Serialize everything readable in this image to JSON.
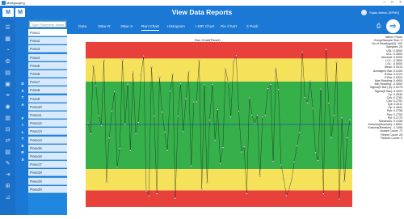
{
  "window": {
    "title": "Multigauging"
  },
  "header": {
    "title": "View Data Reports",
    "logo_text": "M",
    "user": "Sujan Ashok (SPM0)"
  },
  "filters_label": "DATA FILTERS",
  "search": {
    "placeholder": "Type Parameter Name"
  },
  "params": [
    "Para1",
    "Para2",
    "Para3",
    "Para4",
    "Para5",
    "Para6",
    "Para7",
    "Para8",
    "Para9",
    "Para10",
    "Para11",
    "Para12",
    "Para13",
    "Para14",
    "Para15",
    "Para16",
    "Para17",
    "Para18",
    "Para19",
    "Para20"
  ],
  "tabs": [
    "Data",
    "XBar-R",
    "XBar-S",
    "Run Chart",
    "Histogram",
    "I-MR Chart",
    "Pie Chart",
    "3 Pack"
  ],
  "active_tab": "Run Chart",
  "colors": {
    "header": "#1b78d4",
    "red": "#e8413c",
    "yellow": "#f6e15a",
    "green": "#36b04a"
  },
  "chart_title": "Run Chart(Para1)",
  "stats": [
    "Name: Para1",
    "Group/Sample Size: 5",
    "No of Readings(N): 100",
    "Samples: 20",
    "USL: 0.5000",
    "UCL: 0.3500",
    "Nominal: 0.0000",
    "LCL: -0.3500",
    "LSL: -0.5000",
    "Mean: 0.0013",
    "Average/X Bar: 0.0105",
    "R Bar: 0.0724",
    "S Bar: 0.0324",
    "Max Reading: 0.4900",
    "Min Reading: -0.4900",
    "Sigma(R Bar) (s): 0.0276",
    "Sigma(S Bar): 0.0293",
    "Cp: 0.2846",
    "Cpk: 0.2781",
    "Cpu: 0.2751",
    "Cpl: 0.2811",
    "Pp: 0.2842",
    "Ppk: 0.2758",
    "Ppu: 0.2753",
    "Ppl: 0.2770",
    "Skewness: 0.0158",
    "Kurtosis(Absolute): 1.8502",
    "Kurtosis(Relative): -1.1498",
    "Accept Count: 72",
    "Reject Count: 28",
    "Rework Count: 0"
  ]
}
